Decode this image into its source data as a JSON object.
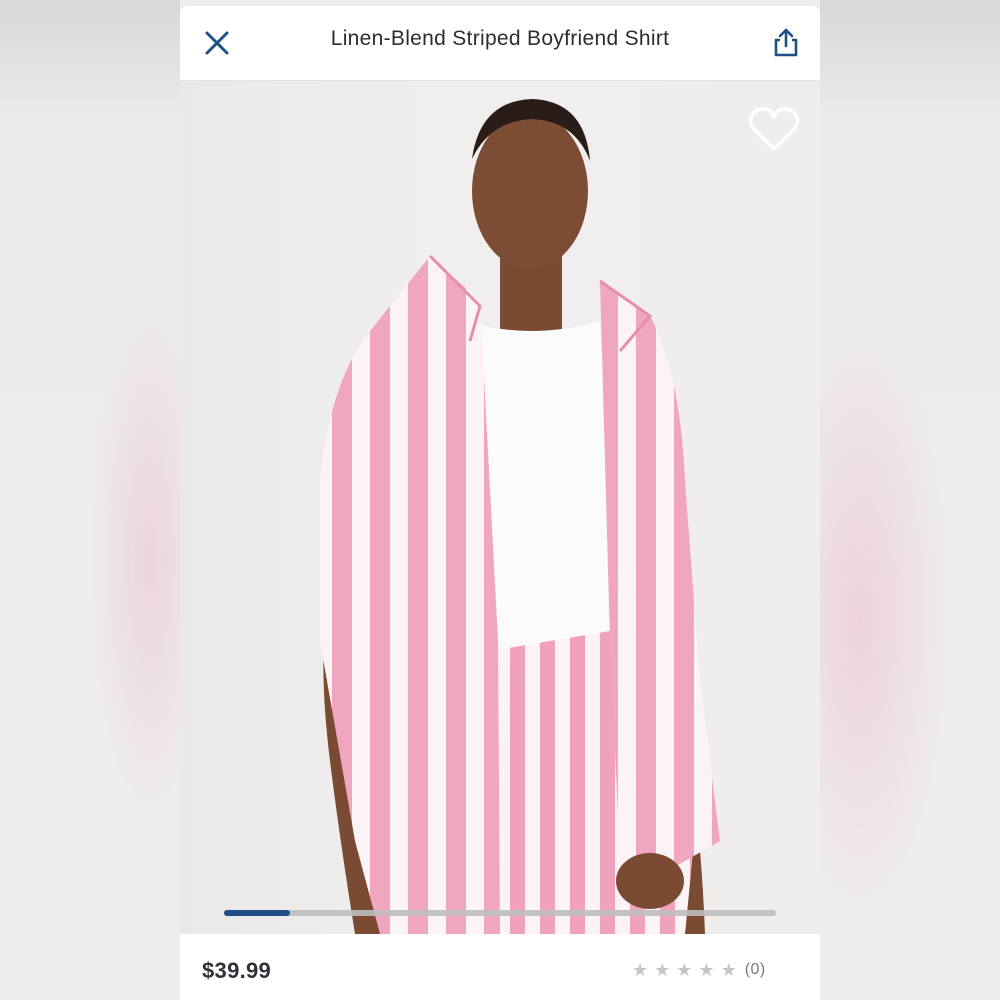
{
  "header": {
    "title": "Linen-Blend Striped Boyfriend Shirt",
    "close_icon": "close-icon",
    "share_icon": "share-icon"
  },
  "gallery": {
    "image": "product-photo-model-wearing-pink-white-striped-shirt-and-shorts",
    "favorite_icon": "heart-outline-icon",
    "carousel_progress": 0.12
  },
  "product": {
    "price": "$39.99",
    "rating_stars": 0,
    "max_stars": 5,
    "review_count": "(0)"
  },
  "colors": {
    "accent": "#1f4f86",
    "stripe_pink": "#f1a6c0",
    "text": "#2a2d33"
  }
}
